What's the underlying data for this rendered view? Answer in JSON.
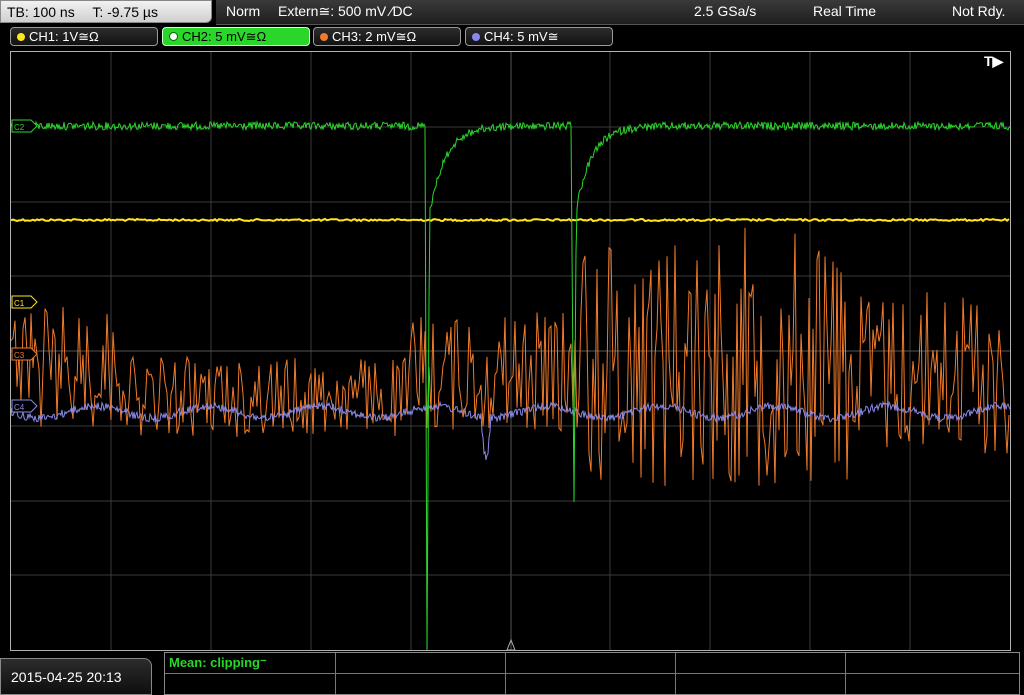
{
  "timebase": {
    "tb": "TB: 100 ns",
    "t": "T: -9.75 µs"
  },
  "acquisition": {
    "mode": "Norm",
    "trigger": "Extern≅: 500 mV ⁄DC",
    "sample_rate": "2.5 GSa/s",
    "state": "Real Time",
    "status": "Not Rdy."
  },
  "channels": [
    {
      "label": "CH1: 1V≅Ω",
      "color": "#ffe81a"
    },
    {
      "label": "CH2: 5 mV≅Ω",
      "color": "#2bd62b"
    },
    {
      "label": "CH3: 2 mV≅Ω",
      "color": "#f07a2a"
    },
    {
      "label": "CH4: 5 mV≅",
      "color": "#8888ee"
    }
  ],
  "markers": {
    "c1": "C1",
    "c2": "C2",
    "c3": "C3",
    "c4": "C4",
    "trigger": "T▶"
  },
  "footer": {
    "datetime": "2015-04-25 20:13",
    "measurement": "Mean: clipping⁻"
  },
  "colors": {
    "ch1": "#ffe81a",
    "ch2": "#2bd62b",
    "ch3": "#f07a2a",
    "ch4": "#8a8ae8",
    "grid": "#404040"
  }
}
